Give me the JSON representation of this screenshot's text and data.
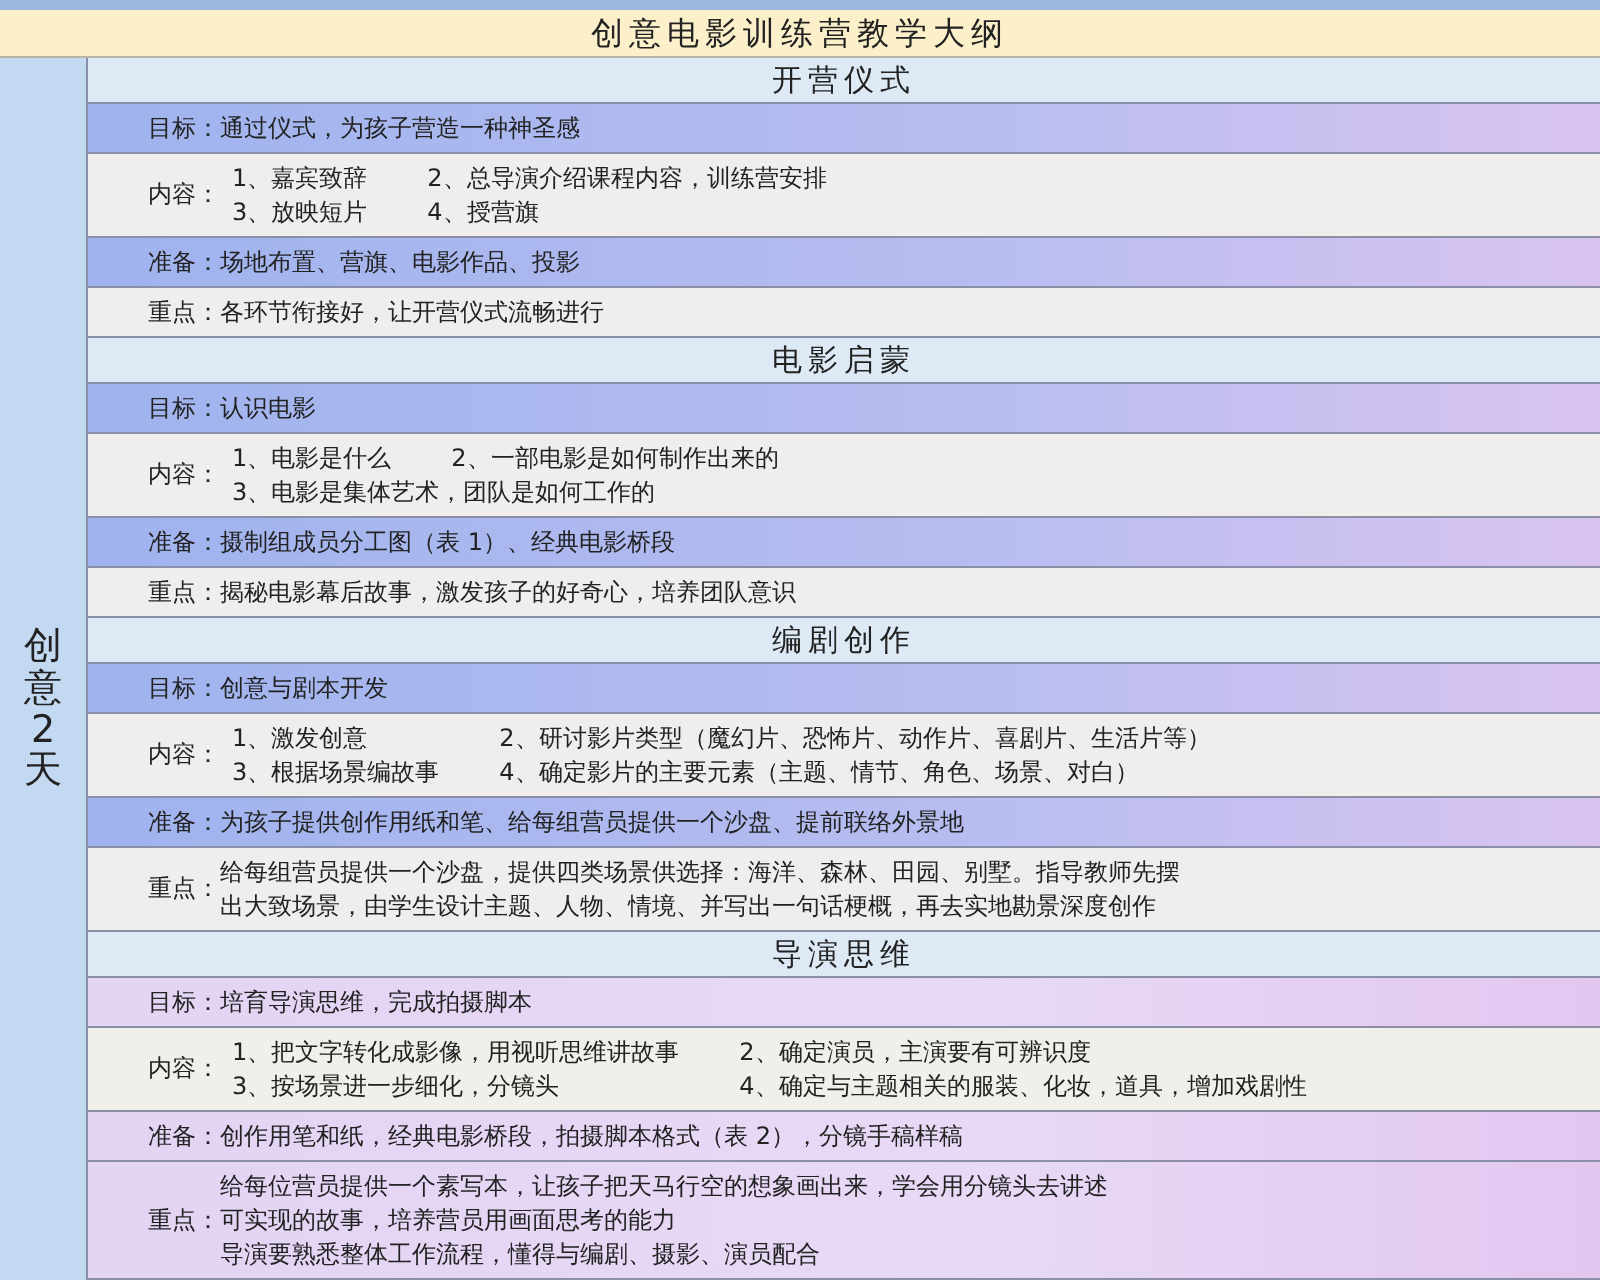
{
  "title": "创意电影训练营教学大纲",
  "side_label": "创意2天",
  "sections": [
    {
      "heading": "开营仪式",
      "rows": [
        {
          "kind": "goal",
          "label": "目标：",
          "lines": [
            [
              "通过仪式，为孩子营造一种神圣感"
            ]
          ]
        },
        {
          "kind": "content",
          "label": "内容：",
          "lines": [
            [
              "1、嘉宾致辞",
              "2、总导演介绍课程内容，训练营安排"
            ],
            [
              "3、放映短片",
              "4、授营旗"
            ]
          ]
        },
        {
          "kind": "prep",
          "label": "准备：",
          "lines": [
            [
              "场地布置、营旗、电影作品、投影"
            ]
          ]
        },
        {
          "kind": "focus",
          "label": "重点：",
          "lines": [
            [
              "各环节衔接好，让开营仪式流畅进行"
            ]
          ]
        }
      ]
    },
    {
      "heading": "电影启蒙",
      "rows": [
        {
          "kind": "goal",
          "label": "目标：",
          "lines": [
            [
              "认识电影"
            ]
          ]
        },
        {
          "kind": "content",
          "label": "内容：",
          "lines": [
            [
              "1、电影是什么",
              "2、一部电影是如何制作出来的"
            ],
            [
              "3、电影是集体艺术，团队是如何工作的"
            ]
          ]
        },
        {
          "kind": "prep",
          "label": "准备：",
          "lines": [
            [
              "摄制组成员分工图（表 1）、经典电影桥段"
            ]
          ]
        },
        {
          "kind": "focus",
          "label": "重点：",
          "lines": [
            [
              "揭秘电影幕后故事，激发孩子的好奇心，培养团队意识"
            ]
          ]
        }
      ]
    },
    {
      "heading": "编剧创作",
      "rows": [
        {
          "kind": "goal",
          "label": "目标：",
          "lines": [
            [
              "创意与剧本开发"
            ]
          ]
        },
        {
          "kind": "content",
          "label": "内容：",
          "lines": [
            [
              "1、激发创意",
              "2、研讨影片类型（魔幻片、恐怖片、动作片、喜剧片、生活片等）"
            ],
            [
              "3、根据场景编故事",
              "4、确定影片的主要元素（主题、情节、角色、场景、对白）"
            ]
          ]
        },
        {
          "kind": "prep",
          "label": "准备：",
          "lines": [
            [
              "为孩子提供创作用纸和笔、给每组营员提供一个沙盘、提前联络外景地"
            ]
          ]
        },
        {
          "kind": "focus",
          "label": "重点：",
          "lines": [
            [
              "给每组营员提供一个沙盘，提供四类场景供选择：海洋、森林、田园、别墅。指导教师先摆"
            ],
            [
              "出大致场景，由学生设计主题、人物、情境、并写出一句话梗概，再去实地勘景深度创作"
            ]
          ]
        }
      ]
    },
    {
      "heading": "导演思维",
      "rows": [
        {
          "kind": "goal",
          "label": "目标：",
          "lines": [
            [
              "培育导演思维，完成拍摄脚本"
            ]
          ]
        },
        {
          "kind": "content",
          "label": "内容：",
          "lines": [
            [
              "1、把文字转化成影像，用视听思维讲故事",
              "2、确定演员，主演要有可辨识度"
            ],
            [
              "3、按场景进一步细化，分镜头",
              "4、确定与主题相关的服装、化妆，道具，增加戏剧性"
            ]
          ]
        },
        {
          "kind": "prep",
          "label": "准备：",
          "lines": [
            [
              "创作用笔和纸，经典电影桥段，拍摄脚本格式（表 2），分镜手稿样稿"
            ]
          ]
        },
        {
          "kind": "focus",
          "label": "重点：",
          "lines": [
            [
              "给每位营员提供一个素写本，让孩子把天马行空的想象画出来，学会用分镜头去讲述"
            ],
            [
              "可实现的故事，培养营员用画面思考的能力"
            ],
            [
              "导演要熟悉整体工作流程，懂得与编剧、摄影、演员配合"
            ]
          ]
        }
      ]
    }
  ]
}
